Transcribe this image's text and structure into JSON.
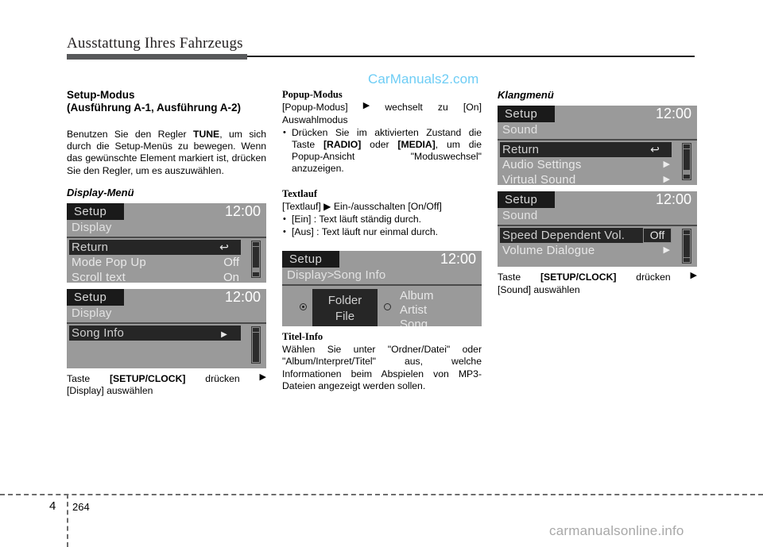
{
  "header": {
    "title": "Ausstattung Ihres Fahrzeugs"
  },
  "watermarks": {
    "top": "CarManuals2.com",
    "bottom": "carmanualsonline.info",
    "top_color": "#6ecdf5",
    "bottom_color": "#a8a8a8"
  },
  "left_column": {
    "heading_line1": "Setup-Modus",
    "heading_line2": "(Ausführung A-1, Ausführung A-2)",
    "intro_parts": {
      "before": "Benutzen Sie den Regler ",
      "bold": "TUNE",
      "after": ", um sich durch die Setup-Menüs zu bewegen. Wenn das gewünschte Element markiert ist, drücken Sie den Regler, um es auszuwählen."
    },
    "display_menu_heading": "Display-Menü",
    "screen1": {
      "title": "Setup",
      "clock": "12:00",
      "subtitle": "Display",
      "rows": [
        {
          "label": "Return",
          "value": "",
          "selected": true,
          "chip": "return-arrow"
        },
        {
          "label": "Mode Pop Up",
          "value": "Off",
          "selected": false,
          "chip": ""
        },
        {
          "label": "Scroll text",
          "value": "On",
          "selected": false,
          "chip": ""
        }
      ]
    },
    "screen2": {
      "title": "Setup",
      "clock": "12:00",
      "subtitle": "Display",
      "rows": [
        {
          "label": "Song Info",
          "value": "",
          "selected": true,
          "chip": "right-arrow"
        }
      ]
    },
    "caption": {
      "word1": "Taste",
      "bold": "[SETUP/CLOCK]",
      "word2": "drücken",
      "arrow": "▶",
      "line2": "[Display] auswählen"
    }
  },
  "mid_column": {
    "popup_heading": "Popup-Modus",
    "popup_line1_a": "[Popup-Modus]",
    "popup_line1_arrow": "▶",
    "popup_line1_b": "wechselt",
    "popup_line1_c": "zu",
    "popup_line1_d": "[On]",
    "popup_line2": "Auswahlmodus",
    "popup_bullet": {
      "p1": "Drücken Sie im aktivierten Zustand die Taste ",
      "b1": "[RADIO]",
      "p2": " oder ",
      "b2": "[MEDIA]",
      "p3": ", um die Popup-Ansicht \"Moduswechsel\" anzuzeigen."
    },
    "textlauf_heading": "Textlauf",
    "textlauf_line": "[Textlauf] ▶ Ein-/ausschalten [On/Off]",
    "textlauf_bullets": [
      "[Ein] : Text läuft ständig durch.",
      "[Aus] : Text läuft nur einmal durch."
    ],
    "songinfo_screen": {
      "title": "Setup",
      "clock": "12:00",
      "subtitle_a": "Display",
      "subtitle_sep": ">",
      "subtitle_b": "Song Info",
      "option_left_line1": "Folder",
      "option_left_line2": "File",
      "option_right_line1": "Album",
      "option_right_line2": "Artist",
      "option_right_line3": "Song",
      "selected_option": "left"
    },
    "titel_info_heading": "Titel-Info",
    "titel_info_body": "Wählen Sie unter \"Ordner/Datei\" oder \"Album/Interpret/Titel\" aus, welche Informationen beim Abspielen von MP3-Dateien angezeigt werden sollen."
  },
  "right_column": {
    "klangmenu_heading": "Klangmenü",
    "screen1": {
      "title": "Setup",
      "clock": "12:00",
      "subtitle": "Sound",
      "rows": [
        {
          "label": "Return",
          "value": "",
          "selected": true,
          "chip": "return-arrow"
        },
        {
          "label": "Audio Settings",
          "value": "",
          "selected": false,
          "chip": "right-arrow"
        },
        {
          "label": "Virtual Sound",
          "value": "",
          "selected": false,
          "chip": "right-arrow"
        }
      ]
    },
    "screen2": {
      "title": "Setup",
      "clock": "12:00",
      "subtitle": "Sound",
      "rows": [
        {
          "label": "Speed Dependent Vol.",
          "value": "Off",
          "selected": true,
          "chip": "value-box"
        },
        {
          "label": "Volume Dialogue",
          "value": "",
          "selected": false,
          "chip": "right-arrow"
        }
      ]
    },
    "caption": {
      "word1": "Taste",
      "bold": "[SETUP/CLOCK]",
      "word2": "drücken",
      "arrow": "▶",
      "line2": "[Sound] auswählen"
    }
  },
  "footer": {
    "chapter": "4",
    "page": "264"
  }
}
